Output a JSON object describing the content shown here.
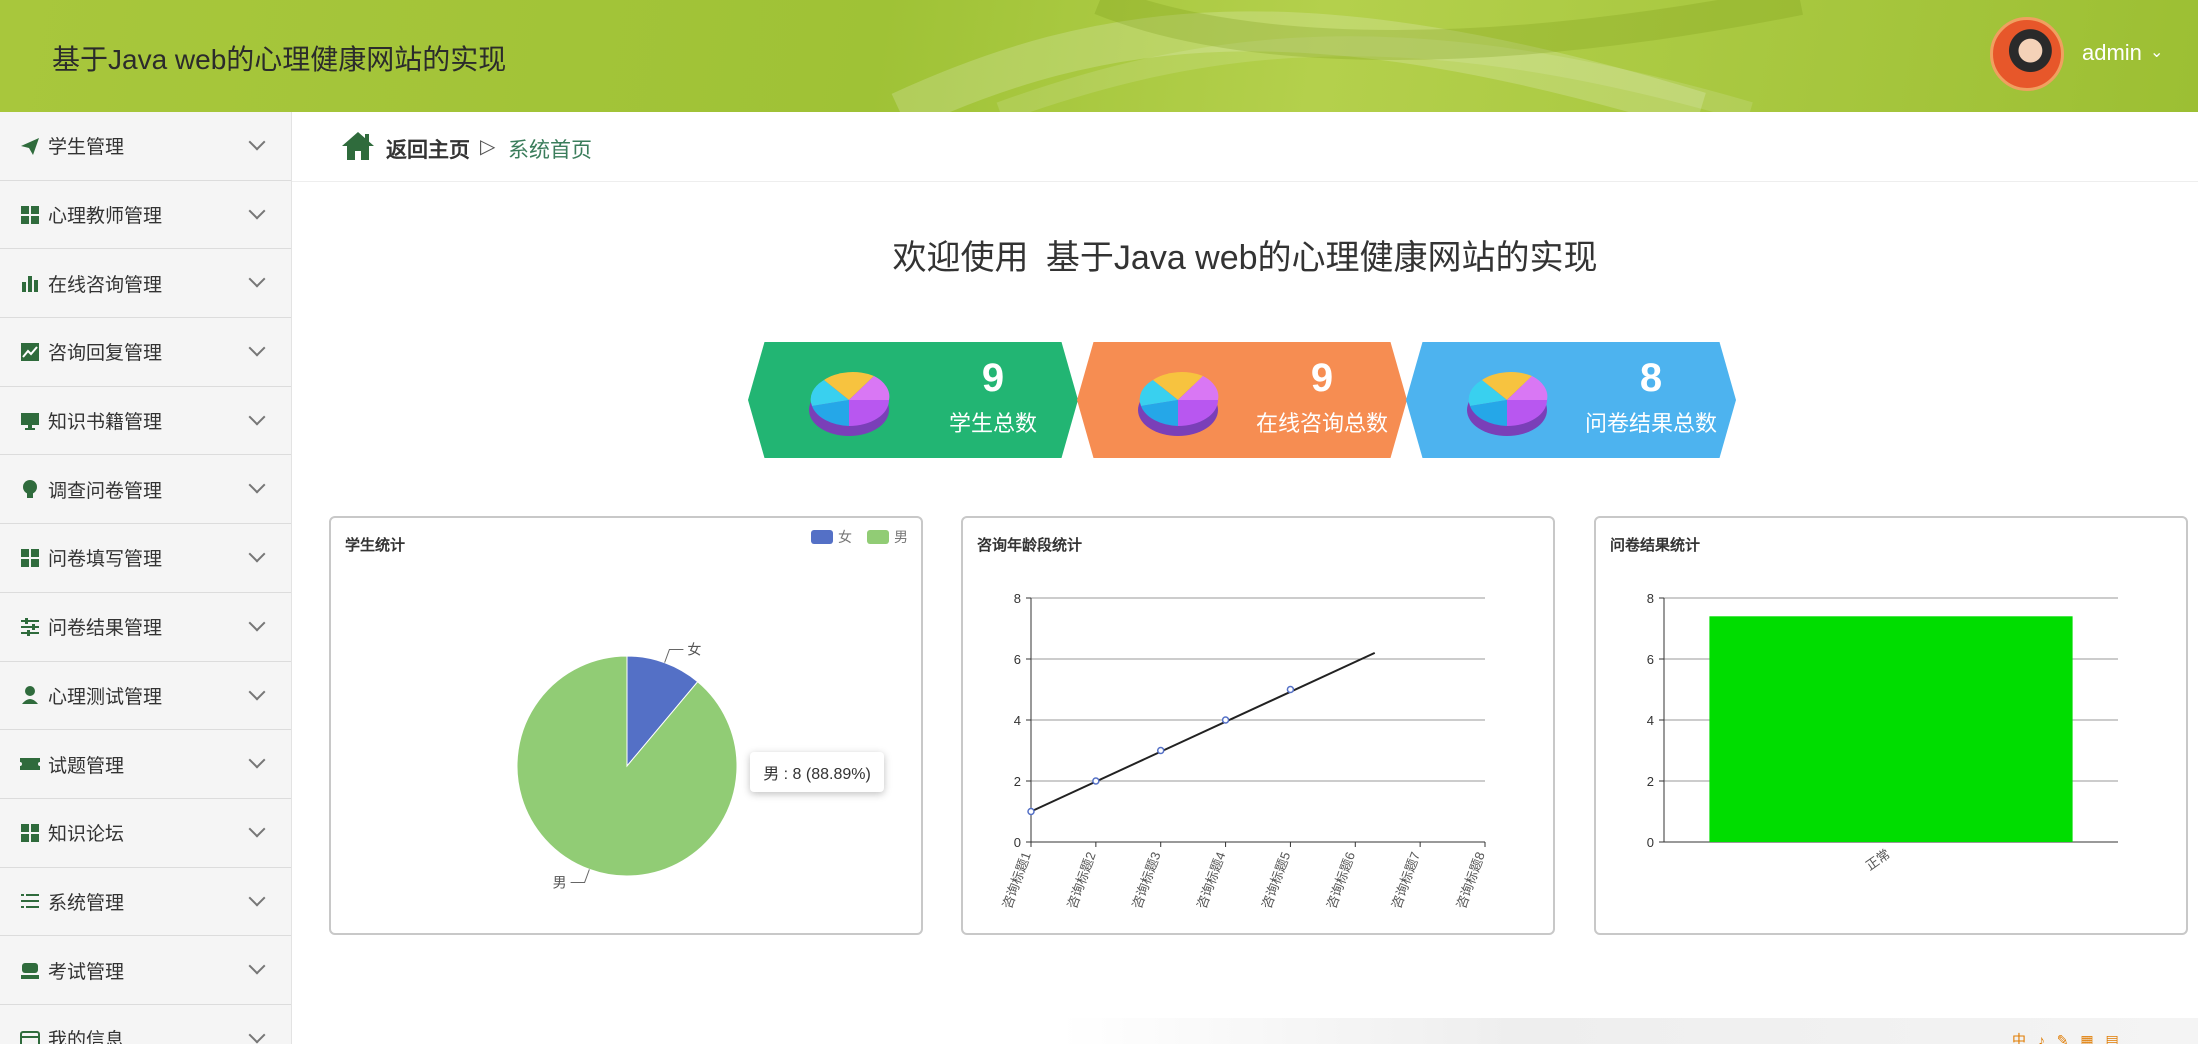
{
  "header": {
    "title": "基于Java web的心理健康网站的实现",
    "user": "admin",
    "caret": "⌄"
  },
  "sidebar": {
    "items": [
      {
        "label": "学生管理",
        "icon": "paper-plane-icon"
      },
      {
        "label": "心理教师管理",
        "icon": "grid-icon"
      },
      {
        "label": "在线咨询管理",
        "icon": "bar-chart-icon"
      },
      {
        "label": "咨询回复管理",
        "icon": "line-chart-icon"
      },
      {
        "label": "知识书籍管理",
        "icon": "monitor-icon"
      },
      {
        "label": "调查问卷管理",
        "icon": "bulb-icon"
      },
      {
        "label": "问卷填写管理",
        "icon": "grid-icon"
      },
      {
        "label": "问卷结果管理",
        "icon": "sliders-icon"
      },
      {
        "label": "心理测试管理",
        "icon": "user-icon"
      },
      {
        "label": "试题管理",
        "icon": "ticket-icon"
      },
      {
        "label": "知识论坛",
        "icon": "grid-icon"
      },
      {
        "label": "系统管理",
        "icon": "list-icon"
      },
      {
        "label": "考试管理",
        "icon": "stamp-icon"
      },
      {
        "label": "我的信息",
        "icon": "card-icon"
      }
    ]
  },
  "breadcrumb": {
    "home": "返回主页",
    "separator": "▷",
    "current": "系统首页"
  },
  "welcome": {
    "prefix": "欢迎使用",
    "name": "基于Java web的心理健康网站的实现"
  },
  "stats": [
    {
      "value": "9",
      "label": "学生总数",
      "color": "#22b573"
    },
    {
      "value": "9",
      "label": "在线咨询总数",
      "color": "#f68d52"
    },
    {
      "value": "8",
      "label": "问卷结果总数",
      "color": "#4db3ef"
    }
  ],
  "tooltip": "男 : 8 (88.89%)",
  "chart_data": [
    {
      "type": "pie",
      "title": "学生统计",
      "legend": [
        "女",
        "男"
      ],
      "legend_position": "top-right",
      "categories": [
        "女",
        "男"
      ],
      "values": [
        1,
        8
      ],
      "colors": [
        "#5470c6",
        "#91cc75"
      ]
    },
    {
      "type": "line",
      "title": "咨询年龄段统计",
      "categories": [
        "咨询标题1",
        "咨询标题2",
        "咨询标题3",
        "咨询标题4",
        "咨询标题5",
        "咨询标题6",
        "咨询标题7",
        "咨询标题8"
      ],
      "values": [
        1,
        2,
        3,
        4,
        5
      ],
      "trend_end": 6.2,
      "ylim": [
        0,
        8
      ],
      "yticks": [
        "0",
        "2",
        "4",
        "6",
        "8"
      ],
      "grid": true
    },
    {
      "type": "bar",
      "title": "问卷结果统计",
      "categories": [
        "正常"
      ],
      "values": [
        7.4
      ],
      "color": "#00dd00",
      "ylim": [
        0,
        8
      ],
      "yticks": [
        "0",
        "2",
        "4",
        "6",
        "8"
      ],
      "grid": true
    }
  ],
  "ime": "中 ♪ ✎ ▦ ▤"
}
